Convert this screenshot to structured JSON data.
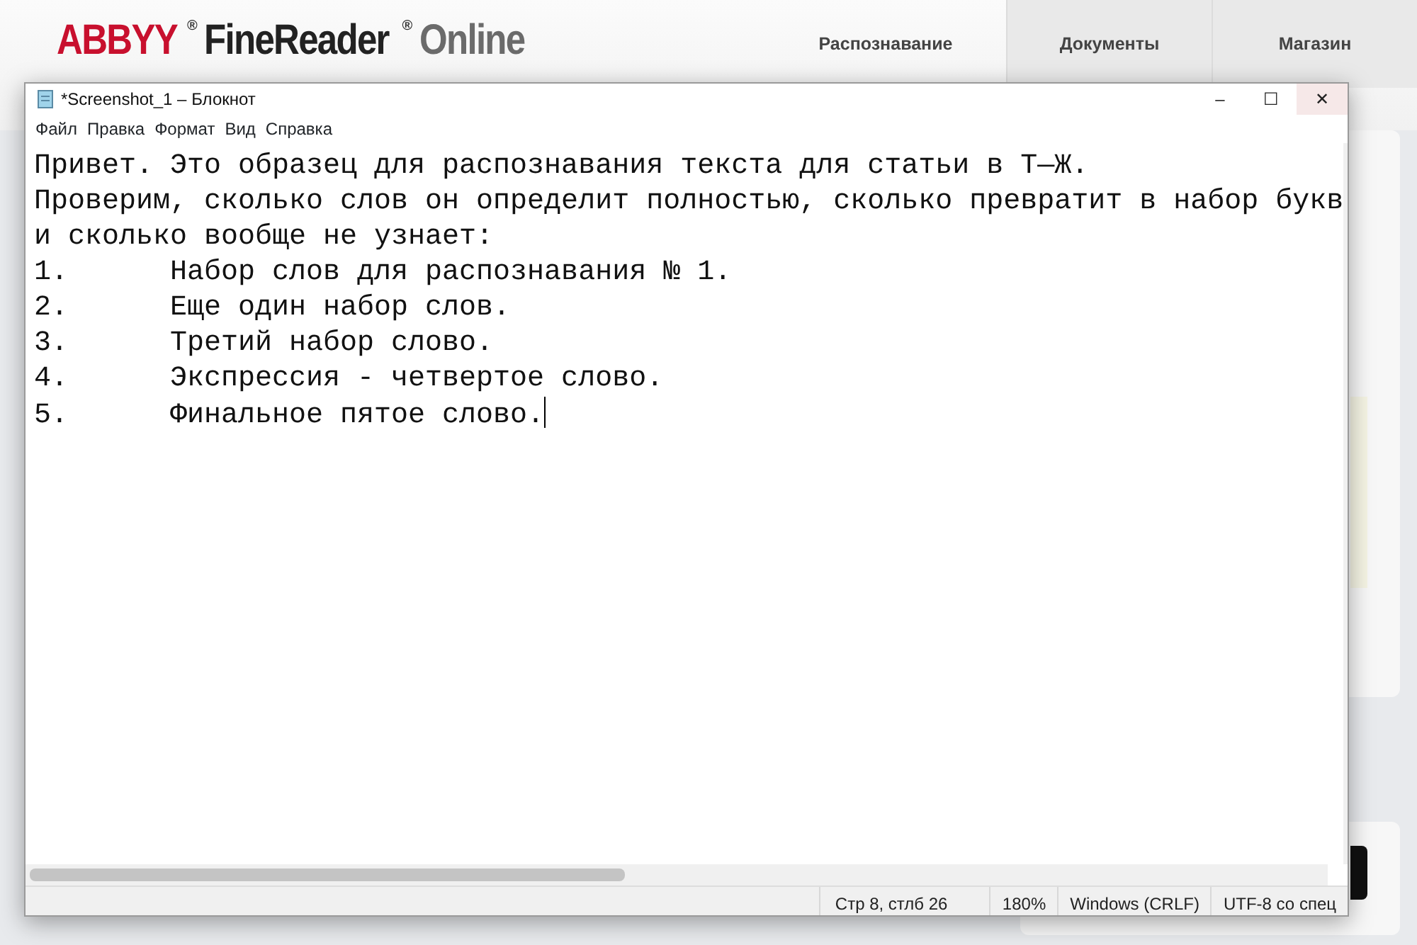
{
  "site": {
    "logo": {
      "brand": "ABBYY",
      "product": "FineReader",
      "suffix": "Online",
      "reg_mark": "®"
    },
    "nav": [
      {
        "label": "Распознавание",
        "selected": true
      },
      {
        "label": "Документы",
        "selected": false
      },
      {
        "label": "Магазин",
        "selected": false
      }
    ]
  },
  "window": {
    "title": "*Screenshot_1 – Блокнот",
    "controls": [
      "–",
      "☐",
      "✕"
    ],
    "menu": [
      "Файл",
      "Правка",
      "Формат",
      "Вид",
      "Справка"
    ],
    "lines": [
      "Привет. Это образец для распознавания текста для статьи в Т—Ж.",
      "Проверим, сколько слов он определит полностью, сколько превратит в набор букв",
      "и сколько вообще не узнает:",
      "1.\tНабор слов для распознавания № 1.",
      "2.\tЕще один набор слов.",
      "3.\tТретий набор слово.",
      "4.\tЭкспрессия - четвертое слово.",
      "5.\tФинальное пятое слово."
    ],
    "status_bar": [
      "Стр 8, стлб 26",
      "180%",
      "Windows (CRLF)",
      "UTF-8 со спец"
    ]
  }
}
